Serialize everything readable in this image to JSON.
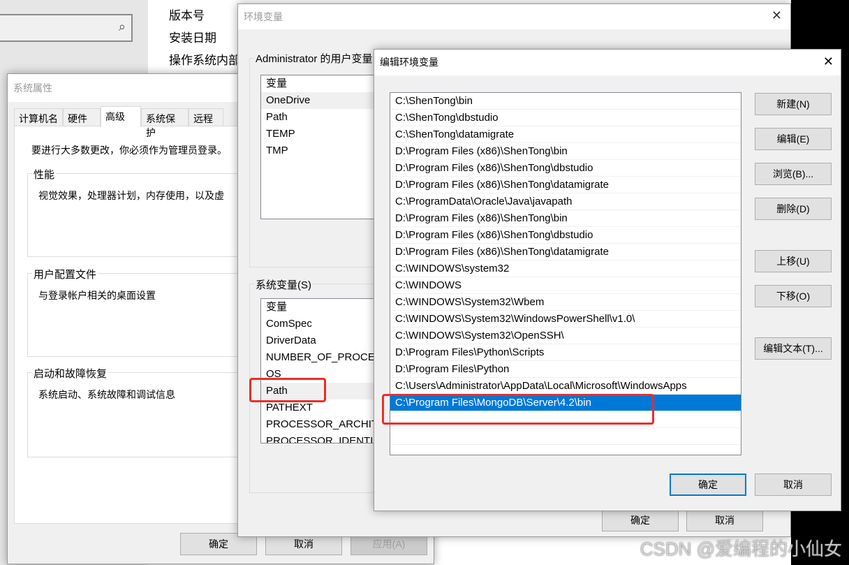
{
  "background": {
    "info_labels": [
      "版本号",
      "安装日期",
      "操作系统内部"
    ]
  },
  "sysprops": {
    "title": "系统属性",
    "tabs": [
      "计算机名",
      "硬件",
      "高级",
      "系统保护",
      "远程"
    ],
    "active_tab": "高级",
    "admin_note": "要进行大多数更改，你必须作为管理员登录。",
    "groups": [
      {
        "label": "性能",
        "text": "视觉效果，处理器计划，内存使用，以及虚"
      },
      {
        "label": "用户配置文件",
        "text": "与登录帐户相关的桌面设置"
      },
      {
        "label": "启动和故障恢复",
        "text": "系统启动、系统故障和调试信息"
      }
    ],
    "buttons": {
      "ok": "确定",
      "cancel": "取消",
      "apply": "应用(A)"
    }
  },
  "envvars": {
    "title": "环境变量",
    "user_group": "Administrator 的用户变量",
    "user_header": "变量",
    "user_vars": [
      "OneDrive",
      "Path",
      "TEMP",
      "TMP"
    ],
    "sys_group": "系统变量(S)",
    "sys_header": "变量",
    "sys_vars": [
      "ComSpec",
      "DriverData",
      "NUMBER_OF_PROCES",
      "OS",
      "Path",
      "PATHEXT",
      "PROCESSOR_ARCHIT",
      "PROCESSOR_IDENTIF"
    ],
    "selected_sys_var": "Path",
    "buttons": {
      "ok": "确定",
      "cancel": "取消"
    }
  },
  "editenv": {
    "title": "编辑环境变量",
    "close": "✕",
    "entries": [
      "C:\\ShenTong\\bin",
      "C:\\ShenTong\\dbstudio",
      "C:\\ShenTong\\datamigrate",
      "D:\\Program Files (x86)\\ShenTong\\bin",
      "D:\\Program Files (x86)\\ShenTong\\dbstudio",
      "D:\\Program Files (x86)\\ShenTong\\datamigrate",
      "C:\\ProgramData\\Oracle\\Java\\javapath",
      "D:\\Program Files (x86)\\ShenTong\\bin",
      "D:\\Program Files (x86)\\ShenTong\\dbstudio",
      "D:\\Program Files (x86)\\ShenTong\\datamigrate",
      "C:\\WINDOWS\\system32",
      "C:\\WINDOWS",
      "C:\\WINDOWS\\System32\\Wbem",
      "C:\\WINDOWS\\System32\\WindowsPowerShell\\v1.0\\",
      "C:\\WINDOWS\\System32\\OpenSSH\\",
      "D:\\Program Files\\Python\\Scripts",
      "D:\\Program Files\\Python",
      "C:\\Users\\Administrator\\AppData\\Local\\Microsoft\\WindowsApps",
      "C:\\Program Files\\MongoDB\\Server\\4.2\\bin"
    ],
    "selected_entry": "C:\\Program Files\\MongoDB\\Server\\4.2\\bin",
    "buttons": {
      "new": "新建(N)",
      "edit": "编辑(E)",
      "browse": "浏览(B)...",
      "delete": "删除(D)",
      "up": "上移(U)",
      "down": "下移(O)",
      "edit_text": "编辑文本(T)...",
      "ok": "确定",
      "cancel": "取消"
    }
  },
  "watermark": "CSDN @爱编程的小仙女",
  "colors": {
    "selection": "#0078d7",
    "annotation": "#f02b2b"
  }
}
